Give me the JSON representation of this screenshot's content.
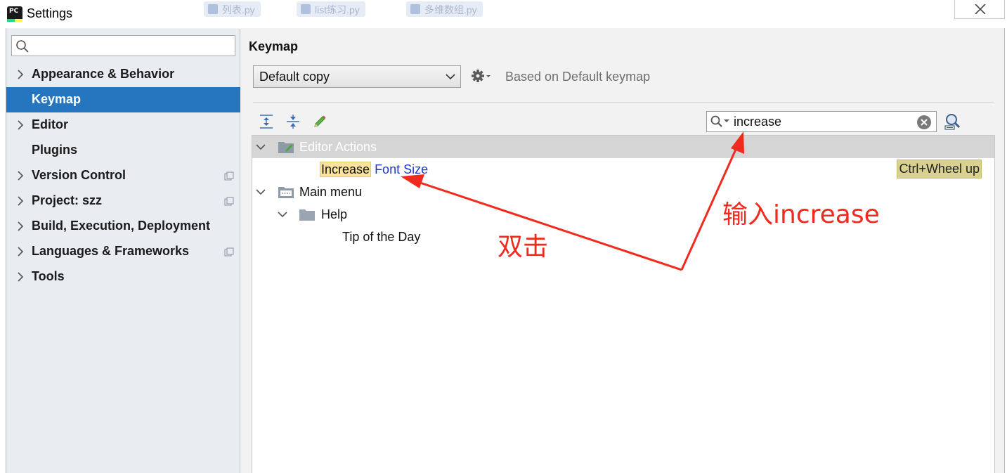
{
  "window": {
    "title": "Settings",
    "background_tabs": [
      "列表.py",
      "list练习.py",
      "多维数组.py"
    ]
  },
  "sidebar": {
    "search": {
      "value": "",
      "placeholder": ""
    },
    "items": [
      {
        "label": "Appearance & Behavior",
        "expandable": true,
        "selected": false,
        "project_scoped": false
      },
      {
        "label": "Keymap",
        "expandable": false,
        "selected": true,
        "project_scoped": false
      },
      {
        "label": "Editor",
        "expandable": true,
        "selected": false,
        "project_scoped": false
      },
      {
        "label": "Plugins",
        "expandable": false,
        "selected": false,
        "project_scoped": false
      },
      {
        "label": "Version Control",
        "expandable": true,
        "selected": false,
        "project_scoped": true
      },
      {
        "label": "Project: szz",
        "expandable": true,
        "selected": false,
        "project_scoped": true
      },
      {
        "label": "Build, Execution, Deployment",
        "expandable": true,
        "selected": false,
        "project_scoped": false
      },
      {
        "label": "Languages & Frameworks",
        "expandable": true,
        "selected": false,
        "project_scoped": true
      },
      {
        "label": "Tools",
        "expandable": true,
        "selected": false,
        "project_scoped": false
      }
    ]
  },
  "main": {
    "title": "Keymap",
    "scheme": {
      "selected": "Default copy"
    },
    "based_on": "Based on Default keymap",
    "toolbar": {
      "expand_all": "expand-all-icon",
      "collapse_all": "collapse-all-icon",
      "edit": "edit-pencil-icon"
    },
    "search": {
      "value": "increase"
    },
    "tree": {
      "editor_actions": {
        "label": "Editor Actions"
      },
      "increase_font_size": {
        "highlight": "Increase",
        "rest": "Font Size",
        "shortcut": "Ctrl+Wheel up"
      },
      "main_menu": {
        "label": "Main menu"
      },
      "help": {
        "label": "Help"
      },
      "tip_of_the_day": {
        "label": "Tip of the Day"
      }
    }
  },
  "annotations": {
    "double_click": "双击",
    "type_increase": "输入increase"
  },
  "colors": {
    "selection_blue": "#2675bf",
    "annotation_red": "#f02a1e",
    "search_highlight": "#fbe39a",
    "shortcut_badge": "#d9d18f",
    "link_blue": "#1e37c9"
  }
}
